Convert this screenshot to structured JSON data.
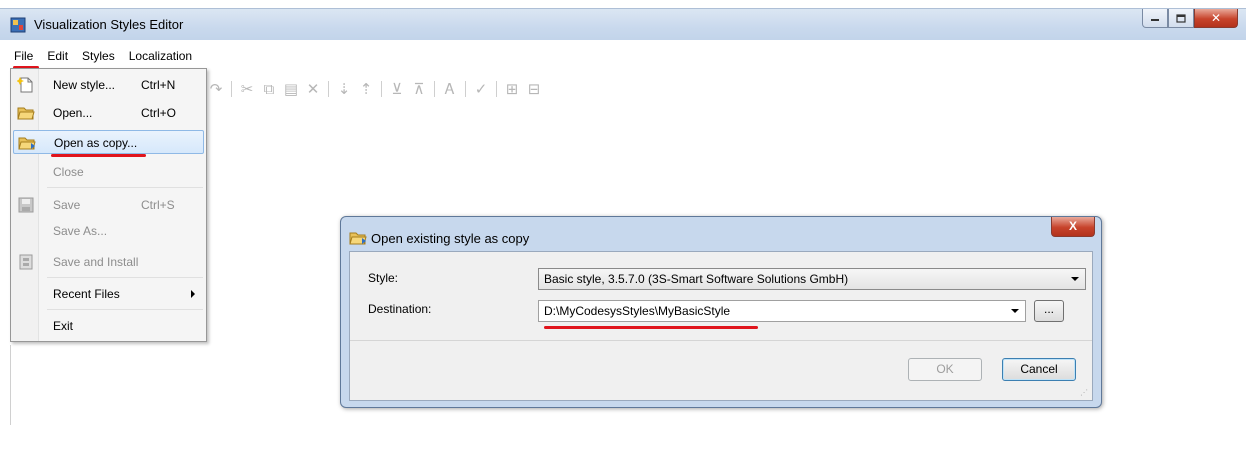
{
  "window": {
    "title": "Visualization Styles Editor",
    "controls": {
      "minimize": "minimize-icon",
      "maximize": "maximize-icon",
      "close": "✕"
    }
  },
  "menubar": [
    "File",
    "Edit",
    "Styles",
    "Localization"
  ],
  "file_menu": {
    "items": [
      {
        "label": "New style...",
        "shortcut": "Ctrl+N",
        "icon": "new-style-icon",
        "enabled": true
      },
      {
        "label": "Open...",
        "shortcut": "Ctrl+O",
        "icon": "open-folder-icon",
        "enabled": true
      },
      {
        "label": "Open as copy...",
        "shortcut": "",
        "icon": "open-copy-icon",
        "enabled": true,
        "highlighted": true
      },
      {
        "label": "Close",
        "shortcut": "",
        "enabled": false
      },
      {
        "label": "Save",
        "shortcut": "Ctrl+S",
        "icon": "save-icon",
        "enabled": false
      },
      {
        "label": "Save As...",
        "shortcut": "",
        "enabled": false
      },
      {
        "label": "Save and Install",
        "shortcut": "",
        "icon": "install-icon",
        "enabled": false
      },
      {
        "label": "Recent Files",
        "shortcut": "",
        "enabled": true,
        "submenu": true
      },
      {
        "label": "Exit",
        "shortcut": "",
        "enabled": true
      }
    ]
  },
  "dialog": {
    "title": "Open existing style as copy",
    "close": "X",
    "style_label": "Style:",
    "style_value": "Basic style, 3.5.7.0 (3S-Smart Software Solutions GmbH)",
    "destination_label": "Destination:",
    "destination_value": "D:\\MyCodesysStyles\\MyBasicStyle",
    "browse": "...",
    "ok": "OK",
    "cancel": "Cancel"
  },
  "colors": {
    "annotation_red": "#e0141c",
    "title_bar": "#c9d9ed",
    "highlight": "#d6e8fb"
  }
}
